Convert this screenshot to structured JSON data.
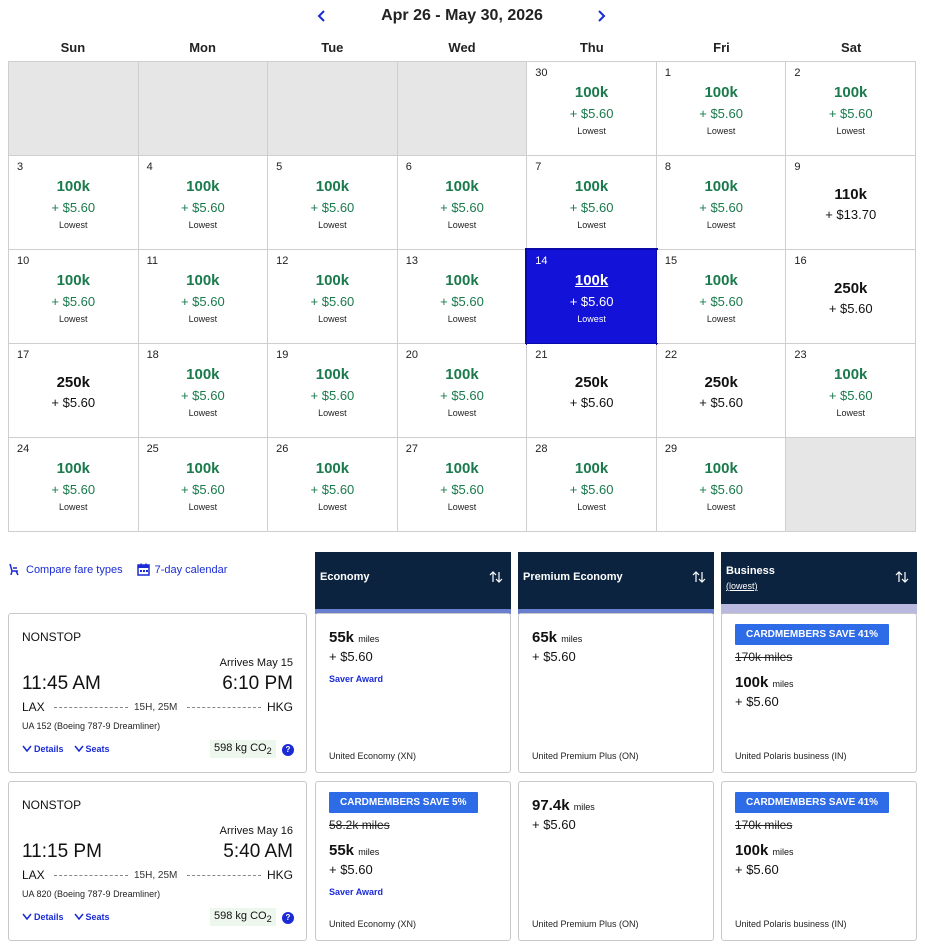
{
  "calendar": {
    "title": "Apr 26 - May 30, 2026",
    "weekdays": [
      "Sun",
      "Mon",
      "Tue",
      "Wed",
      "Thu",
      "Fri",
      "Sat"
    ],
    "lowest_label": "Lowest",
    "selected_day": "14",
    "colors": {
      "lowest_price": "#1a7a4c",
      "selected": "#1212d8",
      "empty": "#e6e6e6"
    },
    "cells": [
      {
        "empty": true
      },
      {
        "empty": true
      },
      {
        "empty": true
      },
      {
        "empty": true
      },
      {
        "day": "30",
        "miles": "100k",
        "tax": "+ $5.60",
        "lowest": true
      },
      {
        "day": "1",
        "miles": "100k",
        "tax": "+ $5.60",
        "lowest": true
      },
      {
        "day": "2",
        "miles": "100k",
        "tax": "+ $5.60",
        "lowest": true
      },
      {
        "day": "3",
        "miles": "100k",
        "tax": "+ $5.60",
        "lowest": true
      },
      {
        "day": "4",
        "miles": "100k",
        "tax": "+ $5.60",
        "lowest": true
      },
      {
        "day": "5",
        "miles": "100k",
        "tax": "+ $5.60",
        "lowest": true
      },
      {
        "day": "6",
        "miles": "100k",
        "tax": "+ $5.60",
        "lowest": true
      },
      {
        "day": "7",
        "miles": "100k",
        "tax": "+ $5.60",
        "lowest": true
      },
      {
        "day": "8",
        "miles": "100k",
        "tax": "+ $5.60",
        "lowest": true
      },
      {
        "day": "9",
        "miles": "110k",
        "tax": "+ $13.70",
        "lowest": false
      },
      {
        "day": "10",
        "miles": "100k",
        "tax": "+ $5.60",
        "lowest": true
      },
      {
        "day": "11",
        "miles": "100k",
        "tax": "+ $5.60",
        "lowest": true
      },
      {
        "day": "12",
        "miles": "100k",
        "tax": "+ $5.60",
        "lowest": true
      },
      {
        "day": "13",
        "miles": "100k",
        "tax": "+ $5.60",
        "lowest": true
      },
      {
        "day": "14",
        "miles": "100k",
        "tax": "+ $5.60",
        "lowest": true,
        "selected": true
      },
      {
        "day": "15",
        "miles": "100k",
        "tax": "+ $5.60",
        "lowest": true
      },
      {
        "day": "16",
        "miles": "250k",
        "tax": "+ $5.60",
        "lowest": false
      },
      {
        "day": "17",
        "miles": "250k",
        "tax": "+ $5.60",
        "lowest": false
      },
      {
        "day": "18",
        "miles": "100k",
        "tax": "+ $5.60",
        "lowest": true
      },
      {
        "day": "19",
        "miles": "100k",
        "tax": "+ $5.60",
        "lowest": true
      },
      {
        "day": "20",
        "miles": "100k",
        "tax": "+ $5.60",
        "lowest": true
      },
      {
        "day": "21",
        "miles": "250k",
        "tax": "+ $5.60",
        "lowest": false
      },
      {
        "day": "22",
        "miles": "250k",
        "tax": "+ $5.60",
        "lowest": false
      },
      {
        "day": "23",
        "miles": "100k",
        "tax": "+ $5.60",
        "lowest": true
      },
      {
        "day": "24",
        "miles": "100k",
        "tax": "+ $5.60",
        "lowest": true
      },
      {
        "day": "25",
        "miles": "100k",
        "tax": "+ $5.60",
        "lowest": true
      },
      {
        "day": "26",
        "miles": "100k",
        "tax": "+ $5.60",
        "lowest": true
      },
      {
        "day": "27",
        "miles": "100k",
        "tax": "+ $5.60",
        "lowest": true
      },
      {
        "day": "28",
        "miles": "100k",
        "tax": "+ $5.60",
        "lowest": true
      },
      {
        "day": "29",
        "miles": "100k",
        "tax": "+ $5.60",
        "lowest": true
      },
      {
        "empty": true
      }
    ]
  },
  "tools": {
    "compare_label": "Compare fare types",
    "calendar_label": "7-day calendar"
  },
  "fare_columns": [
    {
      "title": "Economy",
      "subtitle": ""
    },
    {
      "title": "Premium Economy",
      "subtitle": ""
    },
    {
      "title": "Business",
      "subtitle": "(lowest)"
    }
  ],
  "flights": [
    {
      "type": "NONSTOP",
      "arrives": "Arrives May 15",
      "depart_time": "11:45 AM",
      "arrive_time": "6:10 PM",
      "origin": "LAX",
      "destination": "HKG",
      "duration": "15H, 25M",
      "aircraft": "UA 152 (Boeing 787-9 Dreamliner)",
      "details_label": "Details",
      "seats_label": "Seats",
      "co2": "598 kg CO",
      "co2_sub": "2",
      "info": "?",
      "fares": {
        "economy": {
          "badge": "",
          "original": "",
          "miles": "55k",
          "unit": "miles",
          "tax": "+ $5.60",
          "saver": "Saver Award",
          "class": "United Economy (XN)"
        },
        "premium": {
          "badge": "",
          "original": "",
          "miles": "65k",
          "unit": "miles",
          "tax": "+ $5.60",
          "saver": "",
          "class": "United Premium Plus (ON)"
        },
        "business": {
          "badge": "CARDMEMBERS SAVE 41%",
          "original": "170k miles",
          "miles": "100k",
          "unit": "miles",
          "tax": "+ $5.60",
          "saver": "",
          "class": "United Polaris business (IN)"
        }
      }
    },
    {
      "type": "NONSTOP",
      "arrives": "Arrives May 16",
      "depart_time": "11:15 PM",
      "arrive_time": "5:40 AM",
      "origin": "LAX",
      "destination": "HKG",
      "duration": "15H, 25M",
      "aircraft": "UA 820 (Boeing 787-9 Dreamliner)",
      "details_label": "Details",
      "seats_label": "Seats",
      "co2": "598 kg CO",
      "co2_sub": "2",
      "info": "?",
      "fares": {
        "economy": {
          "badge": "CARDMEMBERS SAVE 5%",
          "original": "58.2k miles",
          "miles": "55k",
          "unit": "miles",
          "tax": "+ $5.60",
          "saver": "Saver Award",
          "class": "United Economy (XN)"
        },
        "premium": {
          "badge": "",
          "original": "",
          "miles": "97.4k",
          "unit": "miles",
          "tax": "+ $5.60",
          "saver": "",
          "class": "United Premium Plus (ON)"
        },
        "business": {
          "badge": "CARDMEMBERS SAVE 41%",
          "original": "170k miles",
          "miles": "100k",
          "unit": "miles",
          "tax": "+ $5.60",
          "saver": "",
          "class": "United Polaris business (IN)"
        }
      }
    }
  ]
}
